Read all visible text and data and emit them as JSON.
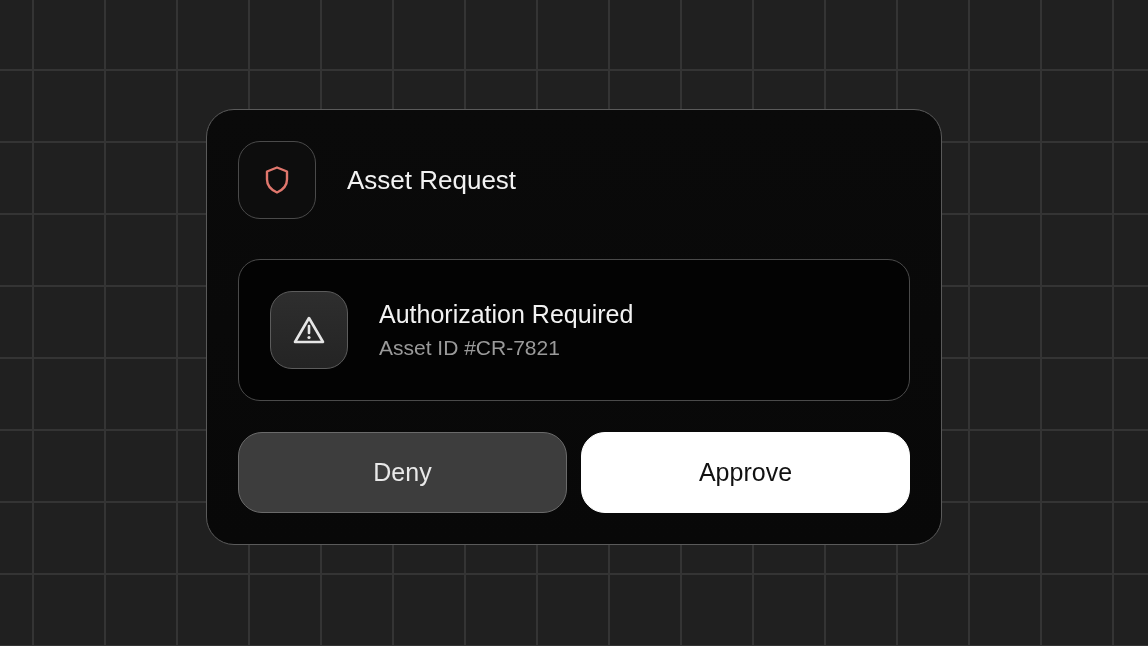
{
  "card": {
    "title": "Asset Request",
    "alert": {
      "title": "Authorization Required",
      "subtitle": "Asset ID #CR-7821"
    },
    "buttons": [
      {
        "label": "Deny",
        "kind": "secondary"
      },
      {
        "label": "Approve",
        "kind": "primary"
      }
    ]
  }
}
